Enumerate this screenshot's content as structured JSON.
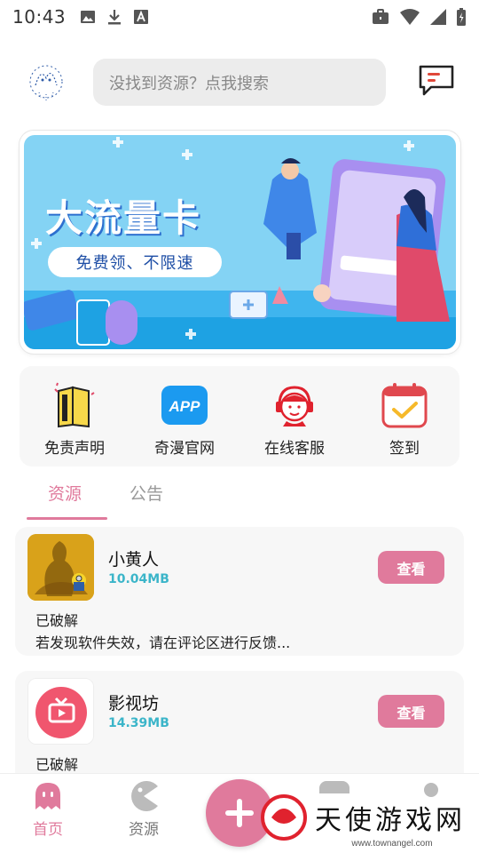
{
  "status_bar": {
    "time": "10:43"
  },
  "header": {
    "search_placeholder": "没找到资源？点我搜索"
  },
  "banner": {
    "title": "大流量卡",
    "subtitle": "免费领、不限速"
  },
  "quick_actions": [
    {
      "label": "免责声明",
      "icon": "book-icon"
    },
    {
      "label": "奇漫官网",
      "icon": "app-icon",
      "icon_text": "APP"
    },
    {
      "label": "在线客服",
      "icon": "customer-service-icon"
    },
    {
      "label": "签到",
      "icon": "calendar-check-icon"
    }
  ],
  "tabs": [
    {
      "label": "资源",
      "active": true
    },
    {
      "label": "公告",
      "active": false
    }
  ],
  "resources": [
    {
      "name": "小黄人",
      "size": "10.04MB",
      "button": "查看",
      "tag": "已破解",
      "description": "若发现软件失效，请在评论区进行反馈..."
    },
    {
      "name": "影视坊",
      "size": "14.39MB",
      "button": "查看",
      "tag": "已破解"
    }
  ],
  "bottom_nav": [
    {
      "label": "首页",
      "active": true
    },
    {
      "label": "资源",
      "active": false
    }
  ],
  "watermark": {
    "text": "天使游戏网",
    "url": "www.townangel.com"
  },
  "colors": {
    "accent": "#e07a9c",
    "size_text": "#3bb5c9",
    "banner_bg": "#84d3f4"
  }
}
